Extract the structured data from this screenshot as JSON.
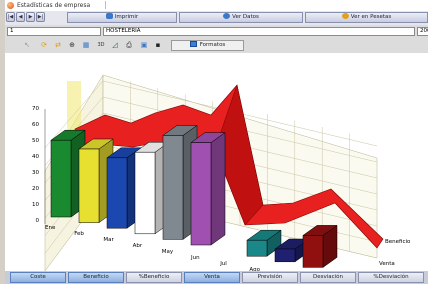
{
  "window": {
    "title": "Estadísticas de empresa"
  },
  "nav": {
    "buttons": [
      "|◀",
      "◀",
      "▶",
      "▶|"
    ],
    "tabs": [
      {
        "label": "Imprimir",
        "icon": "printer-icon",
        "color": "#3a78c8"
      },
      {
        "label": "Ver Datos",
        "icon": "data-icon",
        "color": "#3a78c8"
      },
      {
        "label": "Ver en Pesetas",
        "icon": "coin-icon",
        "color": "#e0a020"
      }
    ]
  },
  "fields": {
    "code": "1",
    "name": "HOSTELERIA",
    "year": "200"
  },
  "toolbar": {
    "icons": [
      "cursor-icon",
      "refresh-icon",
      "rotate-icon",
      "zoom-icon",
      "3d-view-icon",
      "3d-label-icon",
      "chart-type-icon",
      "print-icon",
      "export-icon",
      "save-icon"
    ],
    "formats_label": "Formatos"
  },
  "chart_data": {
    "type": "bar",
    "view": "3D",
    "categories": [
      "Ene",
      "Feb",
      "Mar",
      "Abr",
      "May",
      "Jun",
      "Jul",
      "Ago",
      "Sep",
      "Oct"
    ],
    "series_labels": [
      "Venta",
      "Beneficio"
    ],
    "yticks": [
      "0",
      "10",
      "20",
      "30",
      "40",
      "50",
      "60",
      "70"
    ],
    "ylim": [
      0,
      70
    ],
    "bar_colors": [
      "#1a8a30",
      "#e8e030",
      "#1a48b0",
      "#ffffff",
      "#808890",
      "#a050b0",
      "#b01818",
      "#1a8888",
      "#202070",
      "#901010"
    ],
    "venta": [
      48,
      46,
      44,
      51,
      65,
      64,
      0,
      10,
      8,
      20
    ],
    "beneficio_color": "#e82020",
    "grid": true
  },
  "bottom_tabs": [
    {
      "label": "Coste",
      "state": "active"
    },
    {
      "label": "Beneficio",
      "state": "active"
    },
    {
      "label": "%Beneficio",
      "state": "normal"
    },
    {
      "label": "Venta",
      "state": "active"
    },
    {
      "label": "Previsión",
      "state": "normal"
    },
    {
      "label": "Desviación",
      "state": "normal"
    },
    {
      "label": "%Desviación",
      "state": "normal"
    }
  ]
}
